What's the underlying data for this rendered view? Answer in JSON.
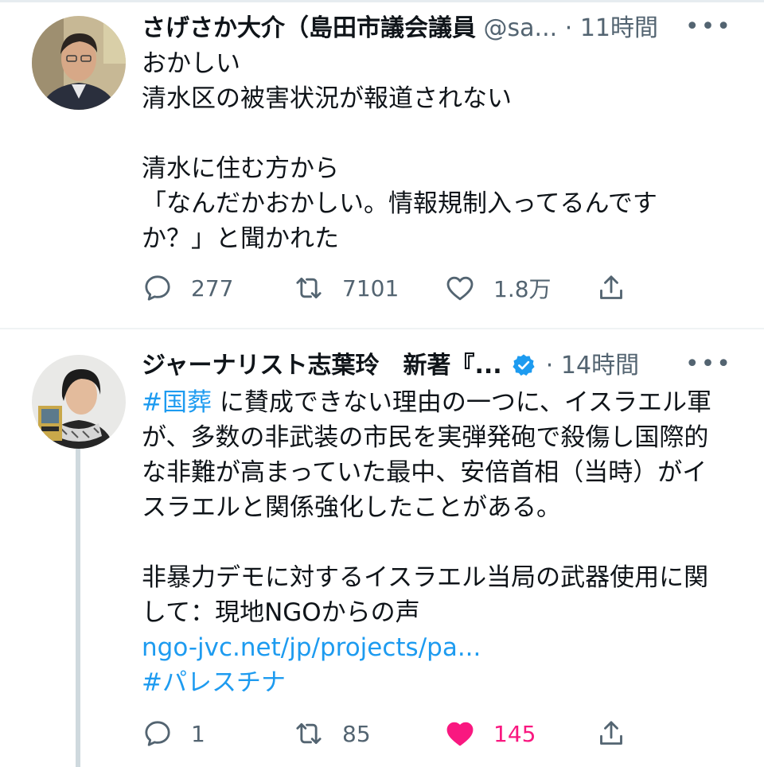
{
  "tweets": [
    {
      "author_name": "さげさか大介（島田市議会議員",
      "handle": "@sa...",
      "separator": "·",
      "time": "11時間",
      "more_label": "•••",
      "lines": [
        "おかしい",
        "清水区の被害状況が報道されない",
        "",
        "清水に住む方から",
        "「なんだかおかしい。情報規制入ってるんです",
        "か？」と聞かれた"
      ],
      "replies": "277",
      "retweets": "7101",
      "likes": "1.8万",
      "liked": false,
      "verified": false
    },
    {
      "author_name": "ジャーナリスト志葉玲　新著『...",
      "separator": "·",
      "time": "14時間",
      "more_label": "•••",
      "line1_hashtag": "#国葬",
      "line1_rest": " に賛成できない理由の一つに、イスラエル軍",
      "lines_a": [
        "が、多数の非武装の市民を実弾発砲で殺傷し国際的",
        "な非難が高まっていた最中、安倍首相（当時）がイ",
        "スラエルと関係強化したことがある。"
      ],
      "lines_b": [
        "非暴力デモに対するイスラエル当局の武器使用に関",
        "して：現地NGOからの声"
      ],
      "url": "ngo-jvc.net/jp/projects/pa...",
      "hashtag2": "#パレスチナ",
      "replies": "1",
      "retweets": "85",
      "likes": "145",
      "liked": true,
      "verified": true
    }
  ],
  "colors": {
    "text": "#0f1419",
    "muted": "#536471",
    "link": "#1d9bf0",
    "like_active": "#f91880",
    "verified": "#1d9bf0"
  },
  "icons": {
    "reply": "reply-icon",
    "retweet": "retweet-icon",
    "like": "heart-icon",
    "share": "share-icon",
    "verified": "verified-badge-icon"
  }
}
